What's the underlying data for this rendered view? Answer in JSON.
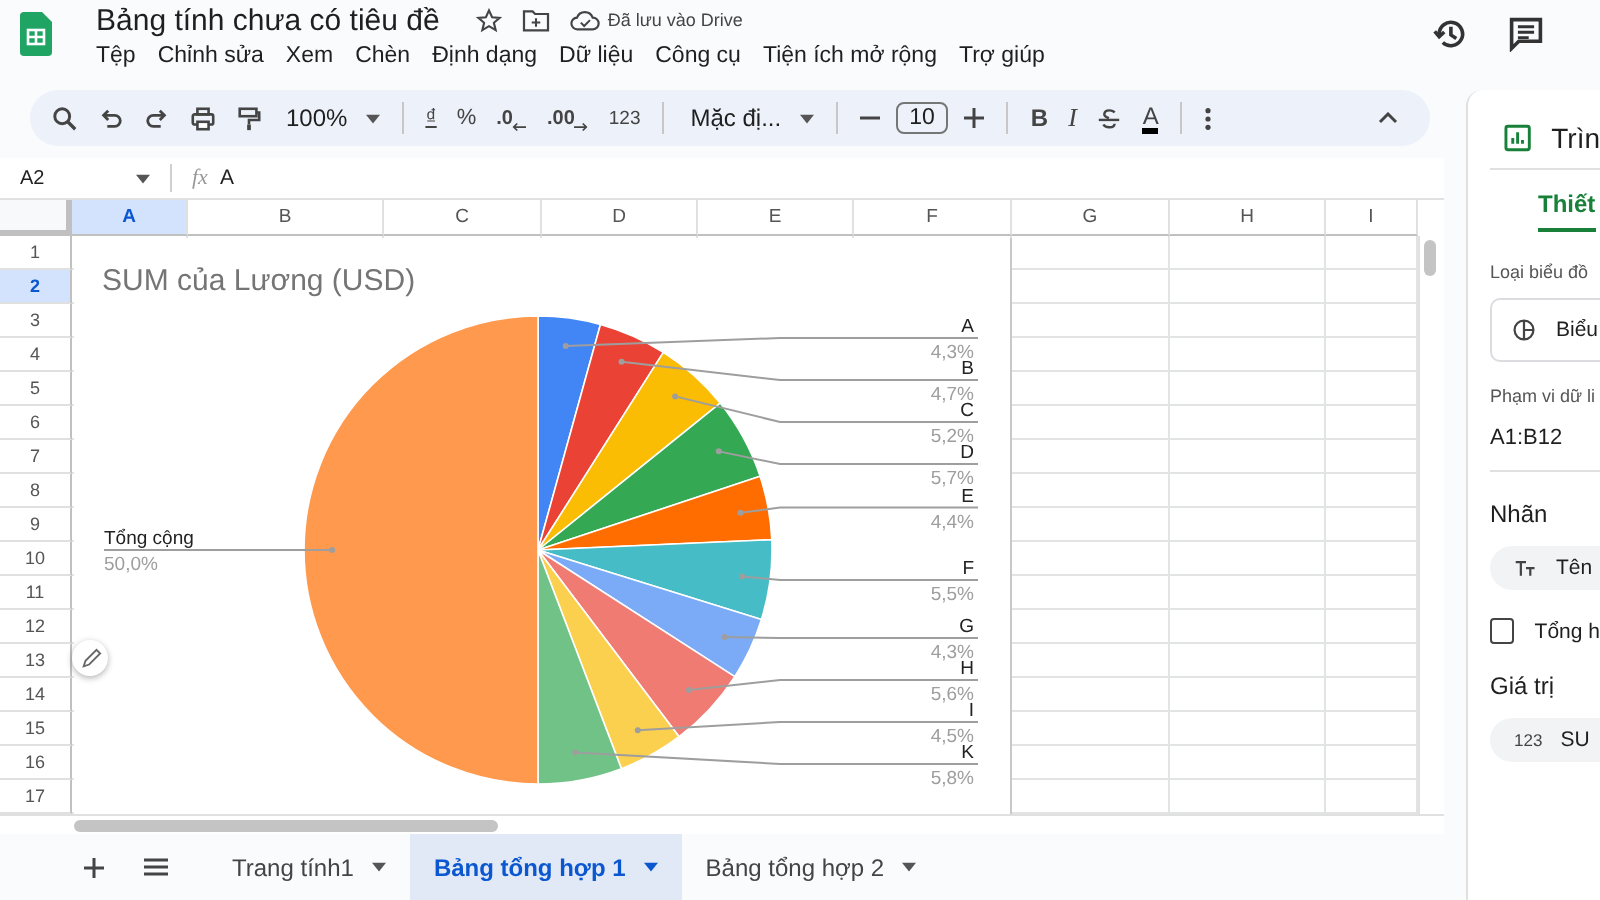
{
  "app": {
    "title": "Bảng tính chưa có tiêu đề",
    "save_status": "Đã lưu vào Drive"
  },
  "menu": [
    "Tệp",
    "Chỉnh sửa",
    "Xem",
    "Chèn",
    "Định dạng",
    "Dữ liệu",
    "Công cụ",
    "Tiện ích mở rộng",
    "Trợ giúp"
  ],
  "toolbar": {
    "zoom": "100%",
    "currency": "₫",
    "percent": "%",
    "decrease_decimals": ".0",
    "increase_decimals": ".00",
    "number_format": "123",
    "font": "Mặc đị...",
    "font_size": "10",
    "bold": "B",
    "italic": "I",
    "text_color": "A"
  },
  "formula_bar": {
    "cell_ref": "A2",
    "fx": "fx",
    "value": "A"
  },
  "columns": [
    {
      "label": "A",
      "selected": true
    },
    {
      "label": "B",
      "selected": false
    },
    {
      "label": "C",
      "selected": false
    },
    {
      "label": "D",
      "selected": false
    },
    {
      "label": "E",
      "selected": false
    },
    {
      "label": "F",
      "selected": false
    },
    {
      "label": "G",
      "selected": false
    },
    {
      "label": "H",
      "selected": false
    },
    {
      "label": "I",
      "selected": false
    }
  ],
  "rows": [
    {
      "label": "1",
      "selected": false
    },
    {
      "label": "2",
      "selected": true
    },
    {
      "label": "3",
      "selected": false
    },
    {
      "label": "4",
      "selected": false
    },
    {
      "label": "5",
      "selected": false
    },
    {
      "label": "6",
      "selected": false
    },
    {
      "label": "7",
      "selected": false
    },
    {
      "label": "8",
      "selected": false
    },
    {
      "label": "9",
      "selected": false
    },
    {
      "label": "10",
      "selected": false
    },
    {
      "label": "11",
      "selected": false
    },
    {
      "label": "12",
      "selected": false
    },
    {
      "label": "13",
      "selected": false
    },
    {
      "label": "14",
      "selected": false
    },
    {
      "label": "15",
      "selected": false
    },
    {
      "label": "16",
      "selected": false
    },
    {
      "label": "17",
      "selected": false
    }
  ],
  "chart": {
    "chart_data": {
      "type": "pie",
      "title": "SUM của Lương (USD)",
      "categories": [
        "A",
        "B",
        "C",
        "D",
        "E",
        "F",
        "G",
        "H",
        "I",
        "K",
        "Tổng cộng"
      ],
      "values": [
        4.3,
        4.7,
        5.2,
        5.7,
        4.4,
        5.5,
        4.3,
        5.6,
        4.5,
        5.8,
        50.0
      ],
      "value_labels": [
        "4,3%",
        "4,7%",
        "5,2%",
        "5,7%",
        "4,4%",
        "5,5%",
        "4,3%",
        "5,6%",
        "4,5%",
        "5,8%",
        "50,0%"
      ]
    }
  },
  "sidebar": {
    "title": "Trìn",
    "tab": "Thiết",
    "chart_type_label": "Loại biểu đồ",
    "chart_type": "Biểu",
    "range_label": "Phạm vi dữ li",
    "range": "A1:B12",
    "labels_heading": "Nhãn",
    "label_chip": "Tên",
    "total_checkbox": {
      "label": "Tổng h",
      "checked": false
    },
    "values_heading": "Giá trị",
    "value_chip_icon": "123",
    "value_chip": "SU"
  },
  "sheet_tabs": [
    {
      "label": "Trang tính1",
      "selected": false
    },
    {
      "label": "Bảng tổng hợp 1",
      "selected": true
    },
    {
      "label": "Bảng tổng hợp 2",
      "selected": false
    }
  ]
}
